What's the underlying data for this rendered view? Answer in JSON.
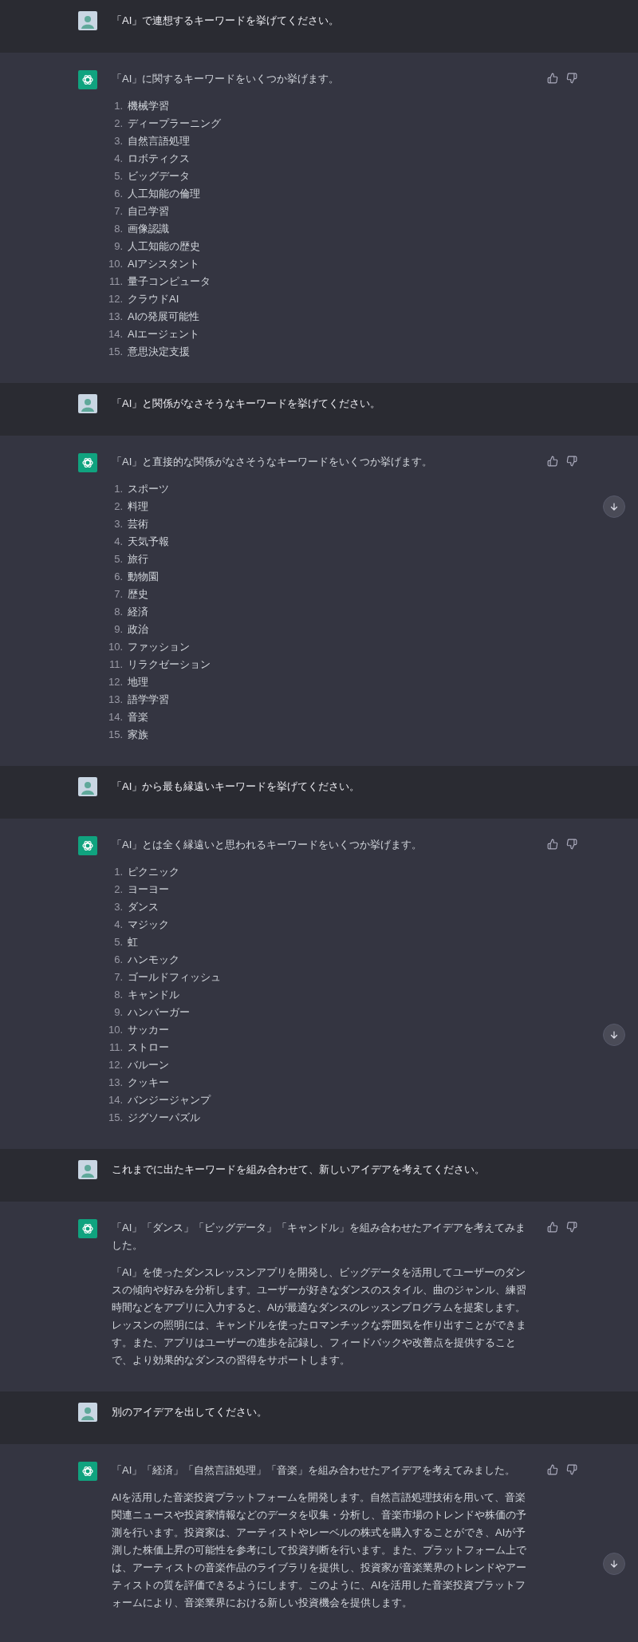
{
  "messages": [
    {
      "kind": "user",
      "text": "「AI」で連想するキーワードを挙げてください。"
    },
    {
      "kind": "assistant",
      "intro": "「AI」に関するキーワードをいくつか挙げます。",
      "scroll_button": false,
      "list": [
        {
          "number": "1.",
          "text": "機械学習"
        },
        {
          "number": "2.",
          "text": "ディープラーニング"
        },
        {
          "number": "3.",
          "text": "自然言語処理"
        },
        {
          "number": "4.",
          "text": "ロボティクス"
        },
        {
          "number": "5.",
          "text": "ビッグデータ"
        },
        {
          "number": "6.",
          "text": "人工知能の倫理"
        },
        {
          "number": "7.",
          "text": "自己学習"
        },
        {
          "number": "8.",
          "text": "画像認識"
        },
        {
          "number": "9.",
          "text": "人工知能の歴史"
        },
        {
          "number": "10.",
          "text": "AIアシスタント"
        },
        {
          "number": "11.",
          "text": "量子コンピュータ"
        },
        {
          "number": "12.",
          "text": "クラウドAI"
        },
        {
          "number": "13.",
          "text": "AIの発展可能性"
        },
        {
          "number": "14.",
          "text": "AIエージェント"
        },
        {
          "number": "15.",
          "text": "意思決定支援"
        }
      ]
    },
    {
      "kind": "user",
      "text": "「AI」と関係がなさそうなキーワードを挙げてください。"
    },
    {
      "kind": "assistant",
      "intro": "「AI」と直接的な関係がなさそうなキーワードをいくつか挙げます。",
      "scroll_button": true,
      "list": [
        {
          "number": "1.",
          "text": "スポーツ"
        },
        {
          "number": "2.",
          "text": "料理"
        },
        {
          "number": "3.",
          "text": "芸術"
        },
        {
          "number": "4.",
          "text": "天気予報"
        },
        {
          "number": "5.",
          "text": "旅行"
        },
        {
          "number": "6.",
          "text": "動物園"
        },
        {
          "number": "7.",
          "text": "歴史"
        },
        {
          "number": "8.",
          "text": "経済"
        },
        {
          "number": "9.",
          "text": "政治"
        },
        {
          "number": "10.",
          "text": "ファッション"
        },
        {
          "number": "11.",
          "text": "リラクゼーション"
        },
        {
          "number": "12.",
          "text": "地理"
        },
        {
          "number": "13.",
          "text": "語学学習"
        },
        {
          "number": "14.",
          "text": "音楽"
        },
        {
          "number": "15.",
          "text": "家族"
        }
      ]
    },
    {
      "kind": "user",
      "text": "「AI」から最も縁遠いキーワードを挙げてください。"
    },
    {
      "kind": "assistant",
      "intro": "「AI」とは全く縁遠いと思われるキーワードをいくつか挙げます。",
      "scroll_button": true,
      "list": [
        {
          "number": "1.",
          "text": "ピクニック"
        },
        {
          "number": "2.",
          "text": "ヨーヨー"
        },
        {
          "number": "3.",
          "text": "ダンス"
        },
        {
          "number": "4.",
          "text": "マジック"
        },
        {
          "number": "5.",
          "text": "虹"
        },
        {
          "number": "6.",
          "text": "ハンモック"
        },
        {
          "number": "7.",
          "text": "ゴールドフィッシュ"
        },
        {
          "number": "8.",
          "text": "キャンドル"
        },
        {
          "number": "9.",
          "text": "ハンバーガー"
        },
        {
          "number": "10.",
          "text": "サッカー"
        },
        {
          "number": "11.",
          "text": "ストロー"
        },
        {
          "number": "12.",
          "text": "バルーン"
        },
        {
          "number": "13.",
          "text": "クッキー"
        },
        {
          "number": "14.",
          "text": "バンジージャンプ"
        },
        {
          "number": "15.",
          "text": "ジグソーパズル"
        }
      ]
    },
    {
      "kind": "user",
      "text": "これまでに出たキーワードを組み合わせて、新しいアイデアを考えてください。"
    },
    {
      "kind": "assistant",
      "intro": "「AI」「ダンス」「ビッグデータ」「キャンドル」を組み合わせたアイデアを考えてみました。",
      "scroll_button": false,
      "paragraph": "「AI」を使ったダンスレッスンアプリを開発し、ビッグデータを活用してユーザーのダンスの傾向や好みを分析します。ユーザーが好きなダンスのスタイル、曲のジャンル、練習時間などをアプリに入力すると、AIが最適なダンスのレッスンプログラムを提案します。レッスンの照明には、キャンドルを使ったロマンチックな雰囲気を作り出すことができます。また、アプリはユーザーの進歩を記録し、フィードバックや改善点を提供することで、より効果的なダンスの習得をサポートします。"
    },
    {
      "kind": "user",
      "text": "別のアイデアを出してください。"
    },
    {
      "kind": "assistant",
      "intro": "「AI」「経済」「自然言語処理」「音楽」を組み合わせたアイデアを考えてみました。",
      "scroll_button": true,
      "paragraph": "AIを活用した音楽投資プラットフォームを開発します。自然言語処理技術を用いて、音楽関連ニュースや投資家情報などのデータを収集・分析し、音楽市場のトレンドや株価の予測を行います。投資家は、アーティストやレーベルの株式を購入することができ、AIが予測した株価上昇の可能性を参考にして投資判断を行います。また、プラットフォーム上では、アーティストの音楽作品のライブラリを提供し、投資家が音楽業界のトレンドやアーティストの質を評価できるようにします。このように、AIを活用した音楽投資プラットフォームにより、音楽業界における新しい投資機会を提供します。"
    }
  ]
}
